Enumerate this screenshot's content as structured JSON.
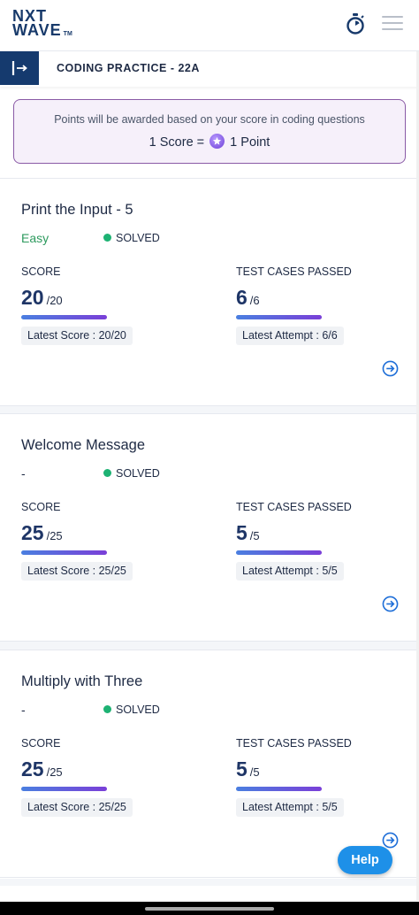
{
  "header": {
    "logo_line1": "NXT",
    "logo_line2": "WAVE",
    "logo_tm": "TM",
    "icons": [
      "stopwatch-icon",
      "menu-icon"
    ]
  },
  "section": {
    "toggle_icon": "sidebar-toggle-icon",
    "title": "CODING PRACTICE - 22A"
  },
  "notice": {
    "text": "Points will be awarded based on your score in coding questions",
    "eq_left": "1 Score = ",
    "eq_icon": "star-coin-icon",
    "eq_right": " 1 Point"
  },
  "labels": {
    "score": "SCORE",
    "test_cases": "TEST CASES PASSED"
  },
  "questions": [
    {
      "title": "Print the Input - 5",
      "difficulty": "Easy",
      "status": "SOLVED",
      "score": "20",
      "score_total": "/20",
      "tests": "6",
      "tests_total": "/6",
      "latest_score": "Latest Score : 20/20",
      "latest_attempt": "Latest Attempt : 6/6"
    },
    {
      "title": "Welcome Message",
      "difficulty": "-",
      "status": "SOLVED",
      "score": "25",
      "score_total": "/25",
      "tests": "5",
      "tests_total": "/5",
      "latest_score": "Latest Score : 25/25",
      "latest_attempt": "Latest Attempt : 5/5"
    },
    {
      "title": "Multiply with Three",
      "difficulty": "-",
      "status": "SOLVED",
      "score": "25",
      "score_total": "/25",
      "tests": "5",
      "tests_total": "/5",
      "latest_score": "Latest Score : 25/25",
      "latest_attempt": "Latest Attempt : 5/5"
    }
  ],
  "help_button": "Help",
  "colors": {
    "brand": "#153a6e",
    "accent_purple": "#8a5aa6",
    "solved_green": "#1db273",
    "easy_green": "#2d9a5e",
    "help_blue": "#1e90e8"
  }
}
